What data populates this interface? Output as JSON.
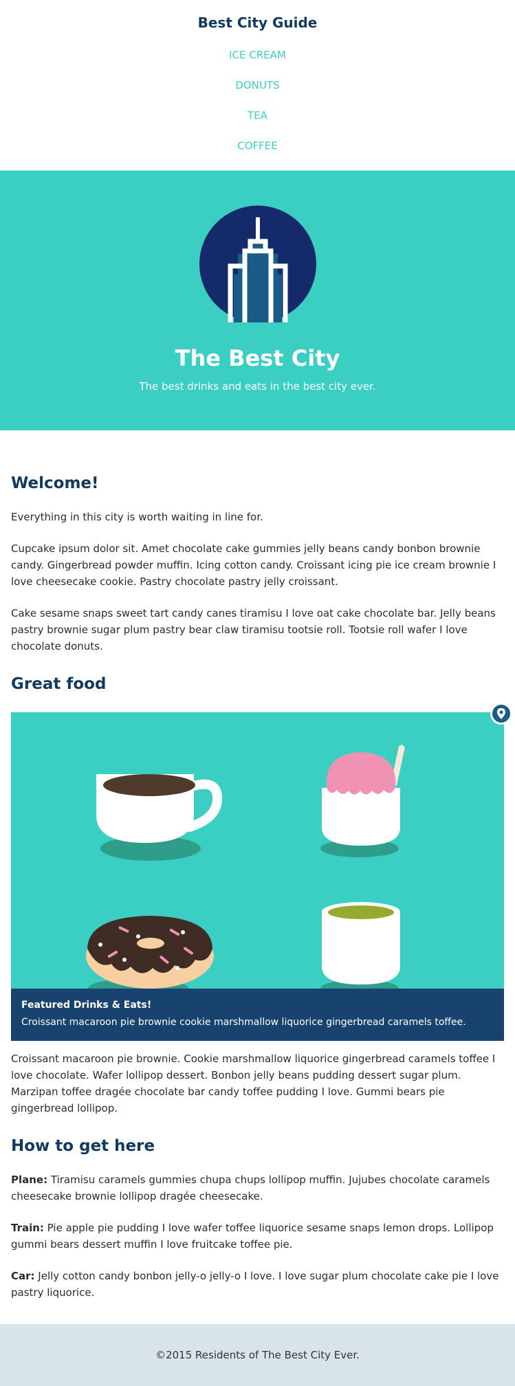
{
  "header": {
    "title": "Best City Guide",
    "nav": [
      "ICE CREAM",
      "DONUTS",
      "TEA",
      "COFFEE"
    ]
  },
  "hero": {
    "title": "The Best City",
    "subtitle": "The best drinks and eats in the best city ever."
  },
  "welcome": {
    "heading": "Welcome!",
    "paragraphs": [
      "Everything in this city is worth waiting in line for.",
      "Cupcake ipsum dolor sit. Amet chocolate cake gummies jelly beans candy bonbon brownie candy. Gingerbread powder muffin. Icing cotton candy. Croissant icing pie ice cream brownie I love cheesecake cookie. Pastry chocolate pastry jelly croissant.",
      "Cake sesame snaps sweet tart candy canes tiramisu I love oat cake chocolate bar. Jelly beans pastry brownie sugar plum pastry bear claw tiramisu tootsie roll. Tootsie roll wafer I love chocolate donuts."
    ]
  },
  "food": {
    "heading": "Great food",
    "caption_title": "Featured Drinks & Eats!",
    "caption_text": "Croissant macaroon pie brownie cookie marshmallow liquorice gingerbread caramels toffee.",
    "paragraph": "Croissant macaroon pie brownie. Cookie marshmallow liquorice gingerbread caramels toffee I love chocolate. Wafer lollipop dessert. Bonbon jelly beans pudding dessert sugar plum. Marzipan toffee dragée chocolate bar candy toffee pudding I love. Gummi bears pie gingerbread lollipop."
  },
  "howto": {
    "heading": "How to get here",
    "items": [
      {
        "label": "Plane:",
        "text": " Tiramisu caramels gummies chupa chups lollipop muffin. Jujubes chocolate caramels cheesecake brownie lollipop dragée cheesecake."
      },
      {
        "label": "Train:",
        "text": " Pie apple pie pudding I love wafer toffee liquorice sesame snaps lemon drops. Lollipop gummi bears dessert muffin I love fruitcake toffee pie."
      },
      {
        "label": "Car:",
        "text": " Jelly cotton candy bonbon jelly-o jelly-o I love. I love sugar plum chocolate cake pie I love pastry liquorice."
      }
    ]
  },
  "footer": {
    "text": "©2015 Residents of The Best City Ever."
  },
  "icons": {
    "logo": "city-building-icon",
    "pin": "map-pin-icon"
  },
  "colors": {
    "teal": "#3bcec3",
    "navy": "#113a5c",
    "caption_bg": "#18436f",
    "footer_bg": "#d8e3ea"
  }
}
